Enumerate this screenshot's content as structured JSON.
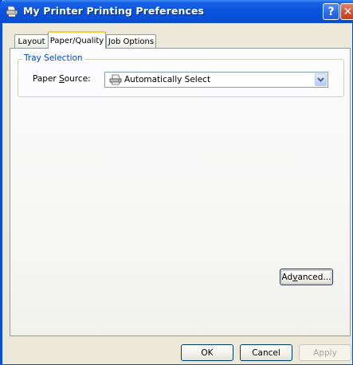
{
  "window": {
    "title": "My Printer Printing Preferences",
    "help_symbol": "?",
    "close_symbol": "✕"
  },
  "tabs": [
    {
      "label": "Layout",
      "active": false
    },
    {
      "label": "Paper/Quality",
      "active": true
    },
    {
      "label": "Job Options",
      "active": false
    }
  ],
  "tray_selection": {
    "group_title": "Tray Selection",
    "paper_source_label_prefix": "Paper ",
    "paper_source_label_access": "S",
    "paper_source_label_suffix": "ource:",
    "paper_source_value": "Automatically Select"
  },
  "buttons": {
    "advanced_prefix": "Ad",
    "advanced_access": "v",
    "advanced_suffix": "anced...",
    "ok": "OK",
    "cancel": "Cancel",
    "apply": "Apply"
  },
  "colors": {
    "titlebar": "#0a55e0",
    "group_title": "#0046d5",
    "active_tab_accent": "#ffc83c"
  }
}
